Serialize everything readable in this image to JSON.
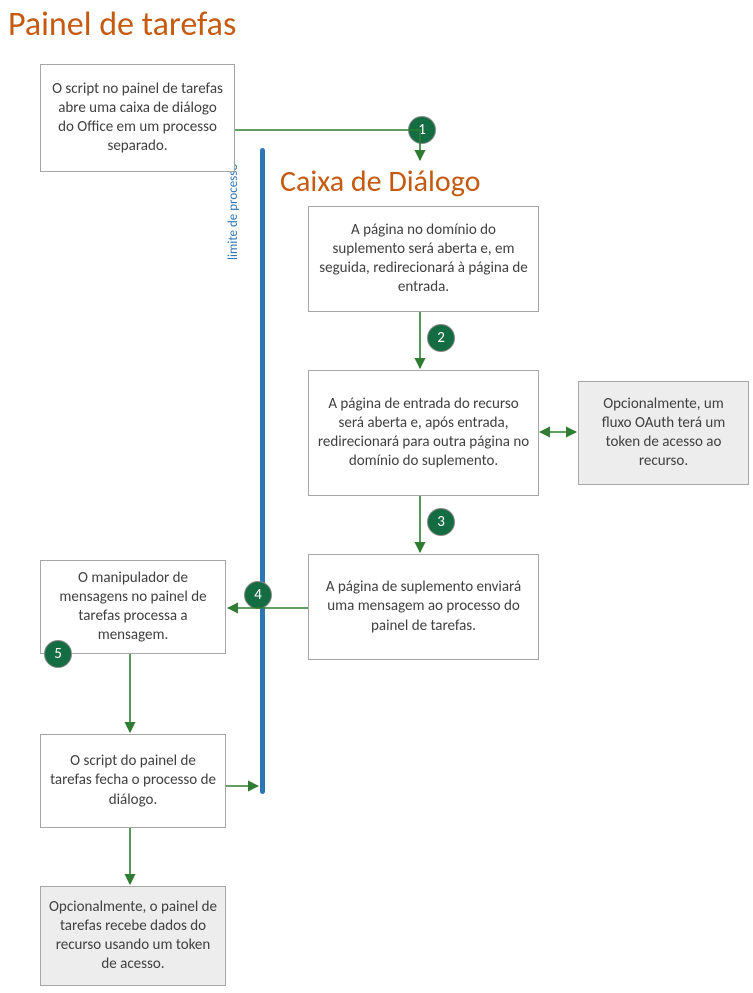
{
  "headings": {
    "taskpane": "Painel de tarefas",
    "dialog": "Caixa de Diálogo"
  },
  "divider_label": "limite de processo",
  "boxes": {
    "tp1": "O script no painel de tarefas abre uma caixa de diálogo do Office em um processo separado.",
    "dlg1": "A página no domínio do suplemento será aberta e, em seguida, redirecionará à página de entrada.",
    "dlg2": "A página de entrada do recurso será aberta e, após entrada, redirecionará para outra página no domínio do suplemento.",
    "oauth": "Opcionalmente, um fluxo OAuth terá um token de acesso ao recurso.",
    "dlg3": "A página de suplemento enviará uma mensagem ao processo do painel de tarefas.",
    "tp2": "O manipulador de mensagens no painel de tarefas processa a mensagem.",
    "tp3": "O script do painel de tarefas fecha o processo de diálogo.",
    "tp4": "Opcionalmente, o painel de tarefas recebe dados do recurso usando um token de acesso."
  },
  "badges": {
    "b1": "1",
    "b2": "2",
    "b3": "3",
    "b4": "4",
    "b5": "5"
  }
}
